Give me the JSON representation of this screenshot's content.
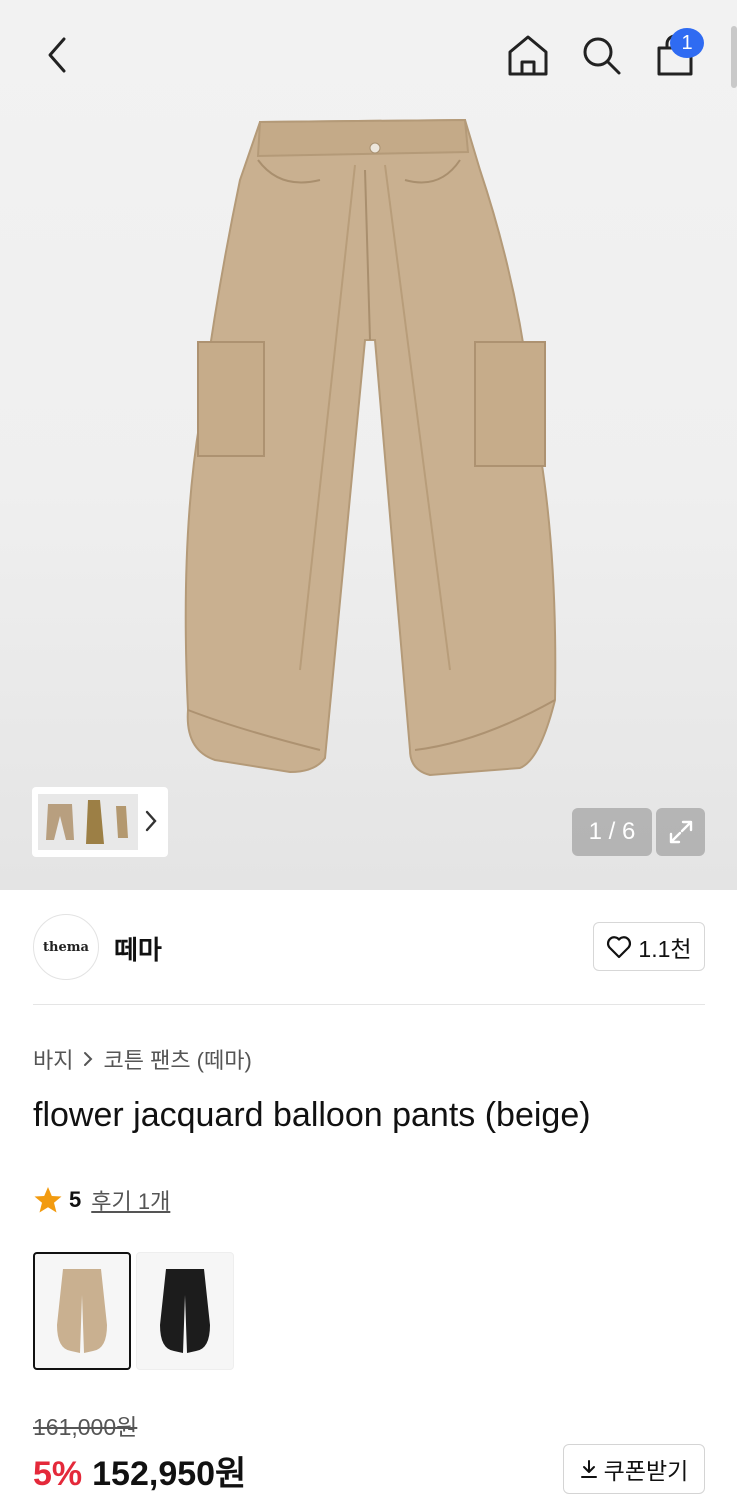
{
  "hero": {
    "image_counter": "1 / 6"
  },
  "brand": {
    "logo_text": "thema",
    "name": "떼마",
    "like_count": "1.1천"
  },
  "breadcrumb": {
    "category": "바지",
    "subcategory": "코튼 팬츠 (떼마)"
  },
  "product": {
    "title": "flower jacquard balloon pants (beige)",
    "rating": "5",
    "review_label": "후기 1개",
    "colors": [
      "beige",
      "black"
    ]
  },
  "price": {
    "original": "161,000원",
    "discount": "5%",
    "sale": "152,950원",
    "coupon_label": "쿠폰받기"
  },
  "cart": {
    "count": "1"
  },
  "colors": {
    "accent_blue": "#2f6bf2",
    "discount_red": "#e4293a",
    "star": "#f29b10"
  }
}
